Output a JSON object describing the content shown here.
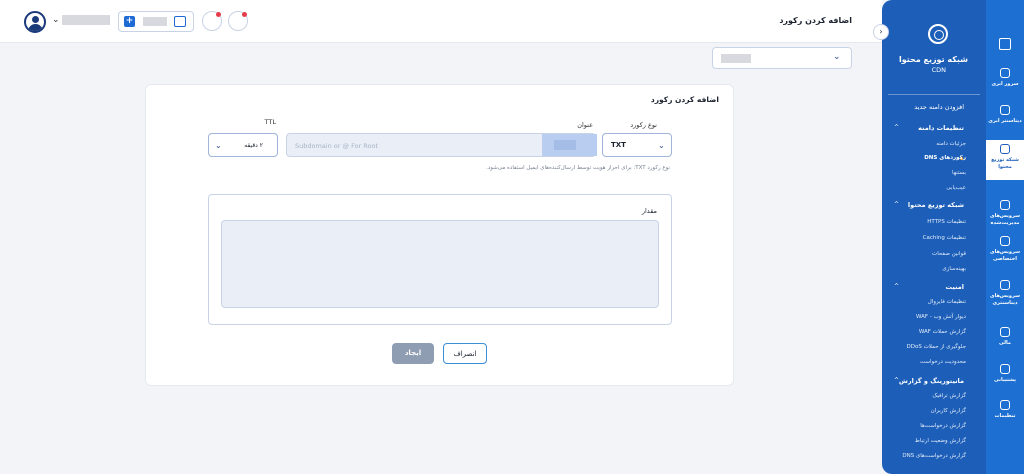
{
  "header": {
    "page_title": "اضافه کردن رکورد"
  },
  "topbar": {
    "user_icon": "user-avatar-icon",
    "credit_plus": "+",
    "wallet_icon": "wallet-icon",
    "bell_icon": "bell-icon",
    "location_icon": "location-icon"
  },
  "domain_select": {
    "chevron": "⌄"
  },
  "form": {
    "card_title": "اضافه کردن رکورد",
    "record_type_label": "نوع رکورد",
    "record_type_value": "TXT",
    "name_label": "عنوان",
    "name_placeholder": "Subdomain or @ For Root",
    "ttl_label": "TTL",
    "ttl_value": "۲ دقیقه",
    "hint": "نوع رکورد TXT: برای احراز هویت توسط ارسال‌کننده‌های ایمیل استفاده می‌شود.",
    "value_label": "مقدار",
    "cancel_label": "انصراف",
    "create_label": "ایجاد"
  },
  "sidepanel": {
    "collapse_icon": "›",
    "title": "شبکه توزیع محتوا",
    "subtitle": "CDN",
    "add_domain": "افزودن دامنه جدید",
    "groups": [
      {
        "title": "تنظیمات دامنه",
        "items": [
          "جزئیات دامنه",
          "رکوردهای DNS",
          "بستنها",
          "عیب‌یابی"
        ]
      },
      {
        "title": "شبکه توزیع محتوا",
        "items": [
          "تنظیمات HTTPS",
          "تنظیمات Caching",
          "قوانین صفحات",
          "بهینه‌سازی"
        ]
      },
      {
        "title": "امنیت",
        "items": [
          "تنظیمات فایروال",
          "دیوار آتش وب - WAF",
          "گزارش حملات WAF",
          "جلوگیری از حملات DDoS",
          "محدودیت درخواست"
        ]
      },
      {
        "title": "مانیتورینگ و گزارش",
        "items": [
          "گزارش ترافیک",
          "گزارش کاربران",
          "گزارش درخواست‌ها",
          "گزارش وضعیت ارتباط",
          "گزارش درخواست‌های DNS"
        ]
      }
    ]
  },
  "iconbar": {
    "items": [
      {
        "label": "سرور ابری",
        "icon": "server-icon"
      },
      {
        "label": "دیتاسنتر ابری",
        "icon": "datacenter-icon"
      },
      {
        "label": "شبکه توزیع محتوا",
        "icon": "cdn-icon"
      },
      {
        "label": "سرویس‌های مدیریت‌شده",
        "icon": "cloud-icon"
      },
      {
        "label": "سرویس‌های اختصاصی",
        "icon": "globe-icon"
      },
      {
        "label": "سرویس‌های دیتاسنتری",
        "icon": "storage-icon"
      },
      {
        "label": "مالی",
        "icon": "invoice-icon"
      },
      {
        "label": "پشتیبانی",
        "icon": "support-icon"
      },
      {
        "label": "تنظیمات",
        "icon": "gear-icon"
      }
    ]
  }
}
